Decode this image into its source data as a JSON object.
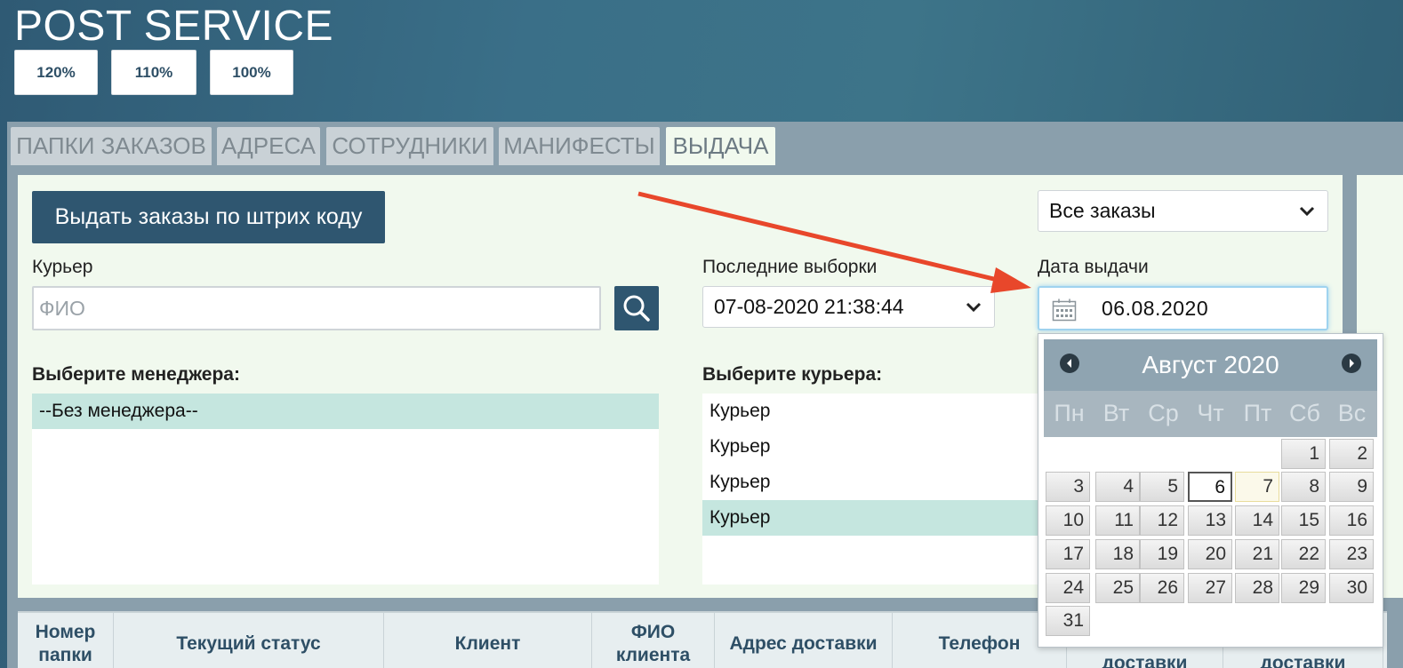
{
  "app_title": "POST SERVICE",
  "zoom_buttons": [
    "120%",
    "110%",
    "100%"
  ],
  "tabs": [
    "ПАПКИ ЗАКАЗОВ",
    "АДРЕСА",
    "СОТРУДНИКИ",
    "МАНИФЕСТЫ",
    "ВЫДАЧА"
  ],
  "active_tab": "ВЫДАЧА",
  "issue_barcode_button": "Выдать заказы по штрих коду",
  "orders_filter": {
    "value": "Все заказы"
  },
  "courier": {
    "label": "Курьер",
    "placeholder": "ФИО"
  },
  "last_selections": {
    "label": "Последние выборки",
    "value": "07-08-2020 21:38:44"
  },
  "issue_date": {
    "label": "Дата выдачи",
    "value": "06.08.2020"
  },
  "manager_list": {
    "label": "Выберите менеджера:",
    "items": [
      "--Без менеджера--"
    ]
  },
  "courier_list": {
    "label": "Выберите курьера:",
    "items": [
      "Курьер",
      "Курьер",
      "Курьер",
      "Курьер"
    ],
    "selected_index": 3
  },
  "calendar": {
    "title": "Август 2020",
    "weekdays": [
      "Пн",
      "Вт",
      "Ср",
      "Чт",
      "Пт",
      "Сб",
      "Вс"
    ],
    "days": [
      "1",
      "2",
      "3",
      "4",
      "5",
      "6",
      "7",
      "8",
      "9",
      "10",
      "11",
      "12",
      "13",
      "14",
      "15",
      "16",
      "17",
      "18",
      "19",
      "20",
      "21",
      "22",
      "23",
      "24",
      "25",
      "26",
      "27",
      "28",
      "29",
      "30",
      "31"
    ],
    "selected_day": "6",
    "highlighted_day": "7"
  },
  "table_headers": [
    "Номер папки",
    "Текущий статус",
    "Клиент",
    "ФИО клиента",
    "Адрес доставки",
    "Телефон",
    "доставки",
    "доставки"
  ],
  "colors": {
    "primary": "#2f5670",
    "panel_bg": "#f1f9ee",
    "selected_row": "#c5e6df",
    "arrow": "#e8472b"
  }
}
